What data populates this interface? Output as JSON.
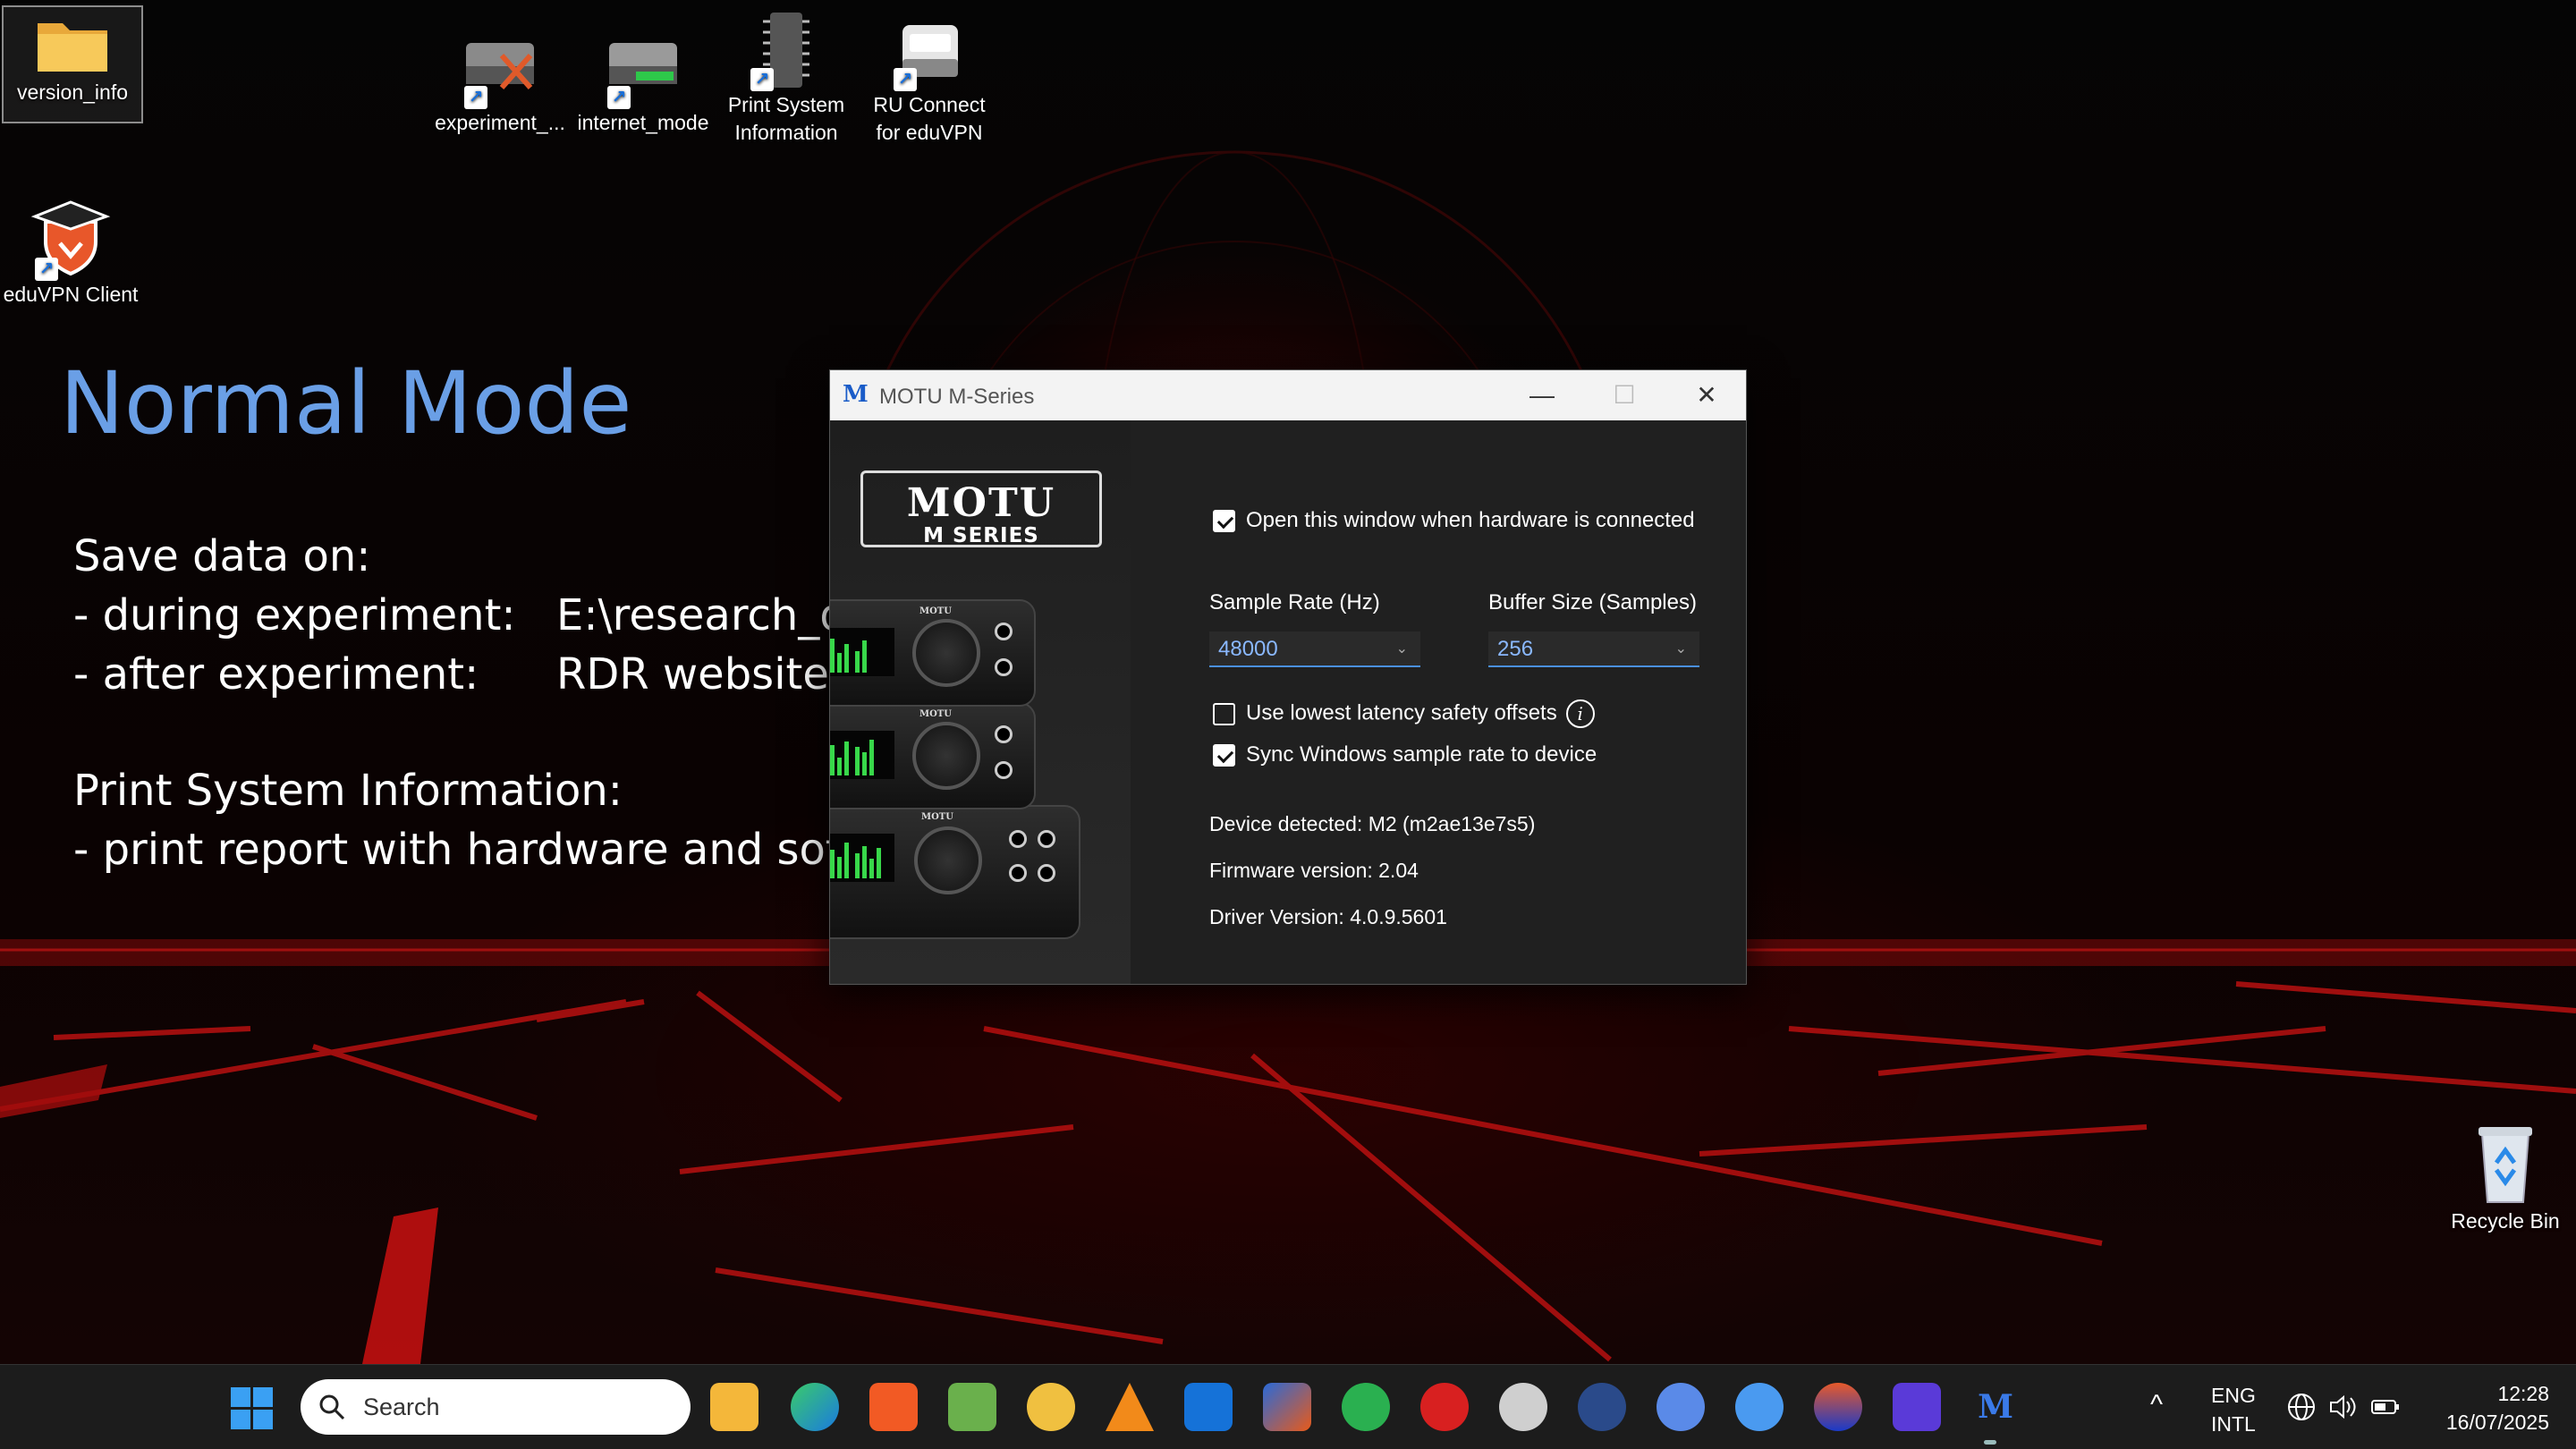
{
  "desktop": {
    "icons": [
      {
        "label": "version_info"
      },
      {
        "label": "experiment_..."
      },
      {
        "label": "internet_mode"
      },
      {
        "label": "Print System Information"
      },
      {
        "label": "RU Connect for eduVPN"
      },
      {
        "label": "eduVPN Client"
      },
      {
        "label": "Recycle Bin"
      }
    ],
    "mode_title": "Normal Mode",
    "info": {
      "save_heading": "Save data on:",
      "during_label": "- during experiment:",
      "during_value": "E:\\research_d",
      "after_label": "- after experiment:",
      "after_value": "RDR website",
      "print_heading": "Print System Information:",
      "print_item": "- print report with hardware and softv"
    }
  },
  "motu_window": {
    "title": "MOTU M-Series",
    "app_icon_letter": "M",
    "controls": {
      "minimize": "—",
      "maximize": "☐",
      "close": "✕"
    },
    "logo": {
      "main": "MOTU",
      "sub": "M SERIES"
    },
    "device_brand": "MOTU",
    "settings": {
      "open_on_connect": {
        "label": "Open this window when hardware is connected",
        "checked": true
      },
      "sample_rate": {
        "label": "Sample Rate (Hz)",
        "value": "48000"
      },
      "buffer_size": {
        "label": "Buffer Size (Samples)",
        "value": "256"
      },
      "lowest_latency": {
        "label": "Use lowest latency safety offsets",
        "checked": false
      },
      "sync_windows": {
        "label": "Sync Windows sample rate to device",
        "checked": true
      }
    },
    "device_info": {
      "detected": "Device detected: M2 (m2ae13e7s5)",
      "firmware": "Firmware version: 2.04",
      "driver": "Driver Version: 4.0.9.5601"
    }
  },
  "taskbar": {
    "search_label": "Search",
    "apps": [
      "file-explorer",
      "edge",
      "brave",
      "notepad",
      "python",
      "vlc",
      "outlook",
      "matlab",
      "praat",
      "acrobat",
      "audacity",
      "network",
      "vpn",
      "connect",
      "eduvpn",
      "video",
      "motu"
    ],
    "language": {
      "line1": "ENG",
      "line2": "INTL"
    },
    "time": "12:28",
    "date": "16/07/2025"
  },
  "colors": {
    "mode_title": "#6a9fe6",
    "accent": "#4a90e2",
    "wallpaper_red": "#c01010"
  }
}
